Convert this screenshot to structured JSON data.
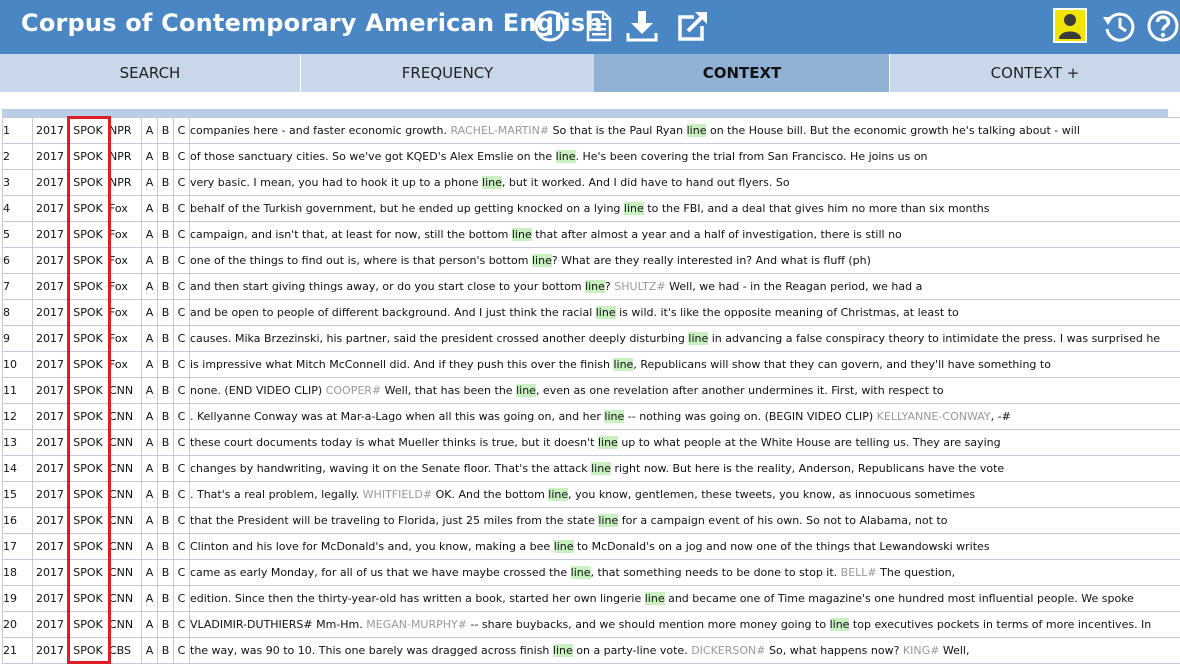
{
  "header": {
    "title": "Corpus of Contemporary American English",
    "icons": [
      "info-icon",
      "document-icon",
      "download-icon",
      "external-link-icon",
      "user-icon",
      "history-icon",
      "help-icon"
    ]
  },
  "colors": {
    "header_bg": "#4a86c4",
    "tab_bar_bg": "#c8d8ea",
    "active_tab_bg": "#8fb1d6",
    "keyword_highlight": "#c8f0c0",
    "speaker_text": "#999999",
    "user_icon_bg": "#f0e400",
    "annotation_box": "#e01c24"
  },
  "tabs": [
    {
      "label": "SEARCH",
      "active": false
    },
    {
      "label": "FREQUENCY",
      "active": false
    },
    {
      "label": "CONTEXT",
      "active": true
    },
    {
      "label": "CONTEXT +",
      "active": false
    }
  ],
  "rows": [
    {
      "num": "1",
      "year": "2017",
      "genre": "SPOK",
      "source": "NPR",
      "a": "A",
      "b": "B",
      "c": "C",
      "segs": [
        {
          "t": "companies here - and faster economic growth. "
        },
        {
          "t": "RACHEL-MARTIN#",
          "s": 1
        },
        {
          "t": " So that is the Paul Ryan "
        },
        {
          "t": "line",
          "k": 1
        },
        {
          "t": " on the House bill. But the economic growth he's talking about - will"
        }
      ]
    },
    {
      "num": "2",
      "year": "2017",
      "genre": "SPOK",
      "source": "NPR",
      "a": "A",
      "b": "B",
      "c": "C",
      "segs": [
        {
          "t": "of those sanctuary cities. So we've got KQED's Alex Emslie on the "
        },
        {
          "t": "line",
          "k": 1
        },
        {
          "t": ". He's been covering the trial from San Francisco. He joins us on"
        }
      ]
    },
    {
      "num": "3",
      "year": "2017",
      "genre": "SPOK",
      "source": "NPR",
      "a": "A",
      "b": "B",
      "c": "C",
      "segs": [
        {
          "t": "very basic. I mean, you had to hook it up to a phone "
        },
        {
          "t": "line",
          "k": 1
        },
        {
          "t": ", but it worked. And I did have to hand out flyers. So"
        }
      ]
    },
    {
      "num": "4",
      "year": "2017",
      "genre": "SPOK",
      "source": "Fox",
      "a": "A",
      "b": "B",
      "c": "C",
      "segs": [
        {
          "t": "behalf of the Turkish government, but he ended up getting knocked on a lying "
        },
        {
          "t": "line",
          "k": 1
        },
        {
          "t": " to the FBI, and a deal that gives him no more than six months"
        }
      ]
    },
    {
      "num": "5",
      "year": "2017",
      "genre": "SPOK",
      "source": "Fox",
      "a": "A",
      "b": "B",
      "c": "C",
      "segs": [
        {
          "t": "campaign, and isn't that, at least for now, still the bottom "
        },
        {
          "t": "line",
          "k": 1
        },
        {
          "t": " that after almost a year and a half of investigation, there is still no"
        }
      ]
    },
    {
      "num": "6",
      "year": "2017",
      "genre": "SPOK",
      "source": "Fox",
      "a": "A",
      "b": "B",
      "c": "C",
      "segs": [
        {
          "t": "one of the things to find out is, where is that person's bottom "
        },
        {
          "t": "line",
          "k": 1
        },
        {
          "t": "? What are they really interested in? And what is fluff (ph)"
        }
      ]
    },
    {
      "num": "7",
      "year": "2017",
      "genre": "SPOK",
      "source": "Fox",
      "a": "A",
      "b": "B",
      "c": "C",
      "segs": [
        {
          "t": "and then start giving things away, or do you start close to your bottom "
        },
        {
          "t": "line",
          "k": 1
        },
        {
          "t": "? "
        },
        {
          "t": "SHULTZ#",
          "s": 1
        },
        {
          "t": " Well, we had - in the Reagan period, we had a"
        }
      ]
    },
    {
      "num": "8",
      "year": "2017",
      "genre": "SPOK",
      "source": "Fox",
      "a": "A",
      "b": "B",
      "c": "C",
      "segs": [
        {
          "t": "and be open to people of different background. And I just think the racial "
        },
        {
          "t": "line",
          "k": 1
        },
        {
          "t": " is wild. it's like the opposite meaning of Christmas, at least to"
        }
      ]
    },
    {
      "num": "9",
      "year": "2017",
      "genre": "SPOK",
      "source": "Fox",
      "a": "A",
      "b": "B",
      "c": "C",
      "segs": [
        {
          "t": "causes. Mika Brzezinski, his partner, said the president crossed another deeply disturbing "
        },
        {
          "t": "line",
          "k": 1
        },
        {
          "t": " in advancing a false conspiracy theory to intimidate the press. I was surprised he"
        }
      ]
    },
    {
      "num": "10",
      "year": "2017",
      "genre": "SPOK",
      "source": "Fox",
      "a": "A",
      "b": "B",
      "c": "C",
      "segs": [
        {
          "t": "is impressive what Mitch McConnell did. And if they push this over the finish "
        },
        {
          "t": "line",
          "k": 1
        },
        {
          "t": ", Republicans will show that they can govern, and they'll have something to"
        }
      ]
    },
    {
      "num": "11",
      "year": "2017",
      "genre": "SPOK",
      "source": "CNN",
      "a": "A",
      "b": "B",
      "c": "C",
      "segs": [
        {
          "t": "none. (END VIDEO CLIP) "
        },
        {
          "t": "COOPER#",
          "s": 1
        },
        {
          "t": " Well, that has been the "
        },
        {
          "t": "line",
          "k": 1
        },
        {
          "t": ", even as one revelation after another undermines it. First, with respect to"
        }
      ]
    },
    {
      "num": "12",
      "year": "2017",
      "genre": "SPOK",
      "source": "CNN",
      "a": "A",
      "b": "B",
      "c": "C",
      "segs": [
        {
          "t": ". Kellyanne Conway was at Mar-a-Lago when all this was going on, and her "
        },
        {
          "t": "line",
          "k": 1
        },
        {
          "t": " -- nothing was going on. (BEGIN VIDEO CLIP) "
        },
        {
          "t": "KELLYANNE-CONWAY",
          "s": 1
        },
        {
          "t": ", -#"
        }
      ]
    },
    {
      "num": "13",
      "year": "2017",
      "genre": "SPOK",
      "source": "CNN",
      "a": "A",
      "b": "B",
      "c": "C",
      "segs": [
        {
          "t": "these court documents today is what Mueller thinks is true, but it doesn't "
        },
        {
          "t": "line",
          "k": 1
        },
        {
          "t": " up to what people at the White House are telling us. They are saying"
        }
      ]
    },
    {
      "num": "14",
      "year": "2017",
      "genre": "SPOK",
      "source": "CNN",
      "a": "A",
      "b": "B",
      "c": "C",
      "segs": [
        {
          "t": "changes by handwriting, waving it on the Senate floor. That's the attack "
        },
        {
          "t": "line",
          "k": 1
        },
        {
          "t": " right now. But here is the reality, Anderson, Republicans have the vote"
        }
      ]
    },
    {
      "num": "15",
      "year": "2017",
      "genre": "SPOK",
      "source": "CNN",
      "a": "A",
      "b": "B",
      "c": "C",
      "segs": [
        {
          "t": ". That's a real problem, legally. "
        },
        {
          "t": "WHITFIELD#",
          "s": 1
        },
        {
          "t": " OK. And the bottom "
        },
        {
          "t": "line",
          "k": 1
        },
        {
          "t": ", you know, gentlemen, these tweets, you know, as innocuous sometimes"
        }
      ]
    },
    {
      "num": "16",
      "year": "2017",
      "genre": "SPOK",
      "source": "CNN",
      "a": "A",
      "b": "B",
      "c": "C",
      "segs": [
        {
          "t": "that the President will be traveling to Florida, just 25 miles from the state "
        },
        {
          "t": "line",
          "k": 1
        },
        {
          "t": " for a campaign event of his own. So not to Alabama, not to"
        }
      ]
    },
    {
      "num": "17",
      "year": "2017",
      "genre": "SPOK",
      "source": "CNN",
      "a": "A",
      "b": "B",
      "c": "C",
      "segs": [
        {
          "t": "Clinton and his love for McDonald's and, you know, making a bee "
        },
        {
          "t": "line",
          "k": 1
        },
        {
          "t": " to McDonald's on a jog and now one of the things that Lewandowski writes"
        }
      ]
    },
    {
      "num": "18",
      "year": "2017",
      "genre": "SPOK",
      "source": "CNN",
      "a": "A",
      "b": "B",
      "c": "C",
      "segs": [
        {
          "t": "came as early Monday, for all of us that we have maybe crossed the "
        },
        {
          "t": "line",
          "k": 1
        },
        {
          "t": ", that something needs to be done to stop it. "
        },
        {
          "t": "BELL#",
          "s": 1
        },
        {
          "t": " The question,"
        }
      ]
    },
    {
      "num": "19",
      "year": "2017",
      "genre": "SPOK",
      "source": "CNN",
      "a": "A",
      "b": "B",
      "c": "C",
      "segs": [
        {
          "t": "edition. Since then the thirty-year-old has written a book, started her own lingerie "
        },
        {
          "t": "line",
          "k": 1
        },
        {
          "t": " and became one of Time magazine's one hundred most influential people. We spoke"
        }
      ]
    },
    {
      "num": "20",
      "year": "2017",
      "genre": "SPOK",
      "source": "CNN",
      "a": "A",
      "b": "B",
      "c": "C",
      "segs": [
        {
          "t": "VLADIMIR-DUTHIERS# Mm-Hm. "
        },
        {
          "t": "MEGAN-MURPHY#",
          "s": 1
        },
        {
          "t": " -- share buybacks, and we should mention more money going to "
        },
        {
          "t": "line",
          "k": 1
        },
        {
          "t": " top executives pockets in terms of more incentives. In"
        }
      ]
    },
    {
      "num": "21",
      "year": "2017",
      "genre": "SPOK",
      "source": "CBS",
      "a": "A",
      "b": "B",
      "c": "C",
      "segs": [
        {
          "t": "the way, was 90 to 10. This one barely was dragged across finish "
        },
        {
          "t": "line",
          "k": 1
        },
        {
          "t": " on a party-line vote. "
        },
        {
          "t": "DICKERSON#",
          "s": 1
        },
        {
          "t": " So, what happens now? "
        },
        {
          "t": "KING#",
          "s": 1
        },
        {
          "t": " Well,"
        }
      ]
    }
  ]
}
